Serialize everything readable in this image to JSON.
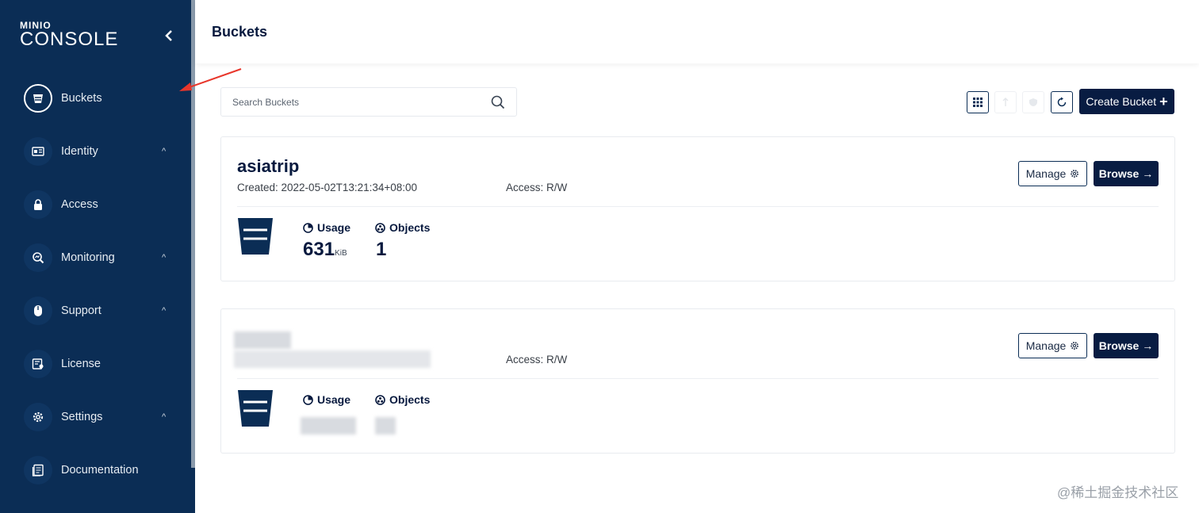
{
  "sidebar": {
    "logo_top": "MINIO",
    "logo_bottom": "CONSOLE",
    "items": [
      {
        "label": "Buckets",
        "icon": "bucket-icon",
        "active": true
      },
      {
        "label": "Identity",
        "icon": "identity-card-icon",
        "caret": "^"
      },
      {
        "label": "Access",
        "icon": "lock-icon"
      },
      {
        "label": "Monitoring",
        "icon": "magnifier-chart-icon",
        "caret": "^"
      },
      {
        "label": "Support",
        "icon": "mouse-icon",
        "caret": "^"
      },
      {
        "label": "License",
        "icon": "license-icon"
      },
      {
        "label": "Settings",
        "icon": "gear-icon",
        "caret": "^"
      },
      {
        "label": "Documentation",
        "icon": "document-icon"
      }
    ]
  },
  "header": {
    "title": "Buckets"
  },
  "search": {
    "placeholder": "Search Buckets"
  },
  "toolbar": {
    "create_label": "Create Bucket",
    "create_plus": "+"
  },
  "buckets": [
    {
      "name": "asiatrip",
      "created": "Created: 2022-05-02T13:21:34+08:00",
      "access": "Access: R/W",
      "usage_label": "Usage",
      "usage_value": "631",
      "usage_unit": "KiB",
      "objects_label": "Objects",
      "objects_value": "1",
      "manage_label": "Manage",
      "browse_label": "Browse →"
    },
    {
      "name": "",
      "created": "",
      "access": "Access: R/W",
      "usage_label": "Usage",
      "objects_label": "Objects",
      "manage_label": "Manage",
      "browse_label": "Browse →"
    }
  ],
  "watermark": "@稀土掘金技术社区",
  "colors": {
    "sidebar_bg": "#0b2d55",
    "primary_dark": "#081c42",
    "annotation_arrow": "#e8362b"
  }
}
